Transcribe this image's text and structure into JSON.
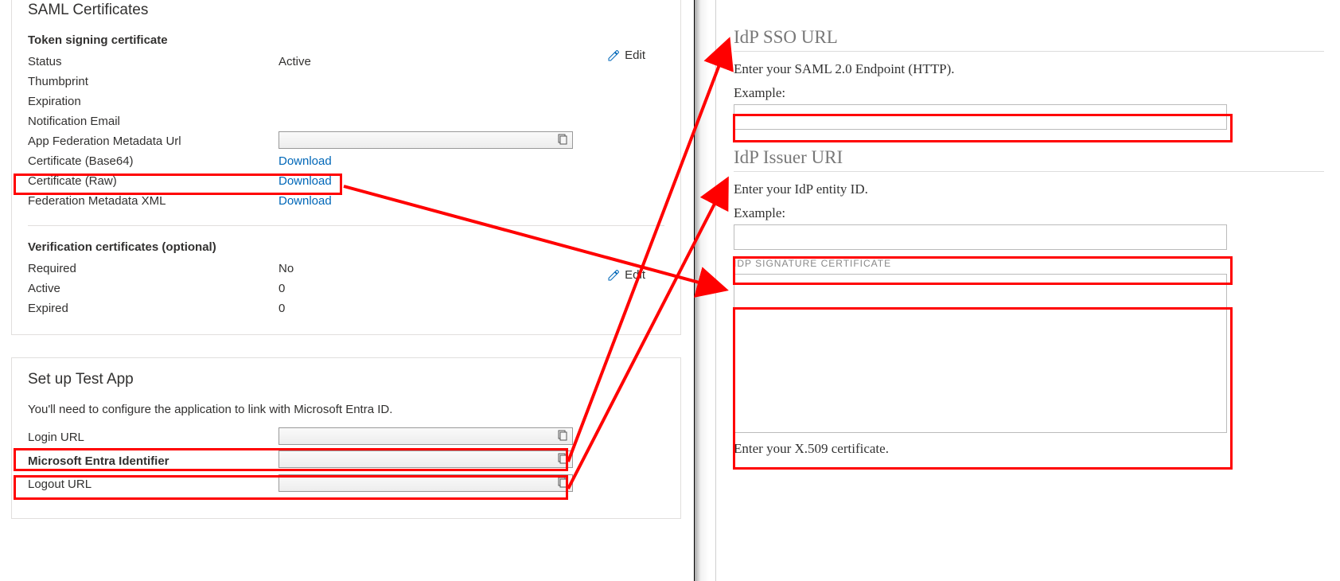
{
  "azure": {
    "saml_certificates": {
      "heading": "SAML Certificates",
      "edit_label": "Edit",
      "token_signing": {
        "title": "Token signing certificate",
        "status_label": "Status",
        "status_value": "Active",
        "thumbprint_label": "Thumbprint",
        "expiration_label": "Expiration",
        "notification_email_label": "Notification Email",
        "app_fed_metadata_url_label": "App Federation Metadata Url",
        "cert_base64_label": "Certificate (Base64)",
        "cert_base64_action": "Download",
        "cert_raw_label": "Certificate (Raw)",
        "cert_raw_action": "Download",
        "fed_metadata_xml_label": "Federation Metadata XML",
        "fed_metadata_xml_action": "Download"
      },
      "verification": {
        "title": "Verification certificates (optional)",
        "required_label": "Required",
        "required_value": "No",
        "active_label": "Active",
        "active_value": "0",
        "expired_label": "Expired",
        "expired_value": "0"
      }
    },
    "setup": {
      "heading": "Set up Test App",
      "description": "You'll need to configure the application to link with Microsoft Entra ID.",
      "login_url_label": "Login URL",
      "entra_identifier_label": "Microsoft Entra Identifier",
      "logout_url_label": "Logout URL"
    }
  },
  "dest": {
    "sso_url": {
      "heading": "IdP SSO URL",
      "help": "Enter your SAML 2.0 Endpoint (HTTP).",
      "example_label": "Example:"
    },
    "issuer": {
      "heading": "IdP Issuer URI",
      "help": "Enter your IdP entity ID.",
      "example_label": "Example:"
    },
    "signature": {
      "label": "IDP SIGNATURE CERTIFICATE",
      "help": "Enter your X.509 certificate."
    }
  },
  "icons": {
    "pencil": "pencil-icon",
    "copy": "copy-icon"
  },
  "annotation_color": "#ff0000"
}
